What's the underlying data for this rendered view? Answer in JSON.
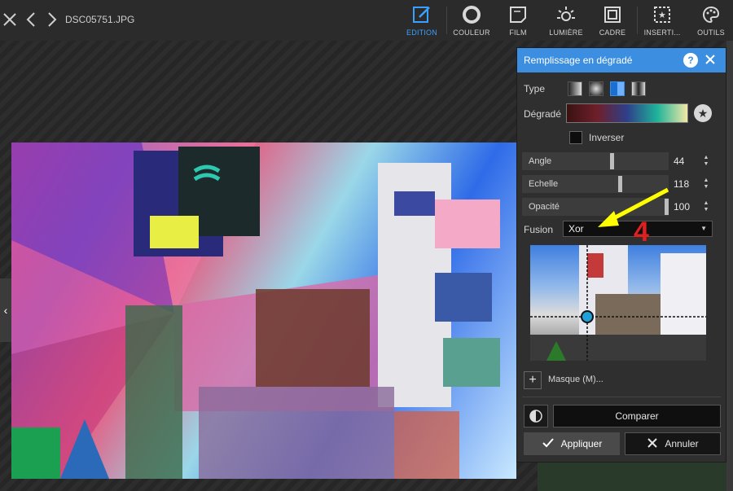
{
  "topbar": {
    "filename": "DSC05751.JPG",
    "tools": [
      {
        "label": "EDITION",
        "icon": "edit-icon",
        "active": true
      },
      {
        "label": "COULEUR",
        "icon": "color-circle-icon",
        "active": false
      },
      {
        "label": "FILM",
        "icon": "film-icon",
        "active": false
      },
      {
        "label": "LUMIÈRE",
        "icon": "sun-icon",
        "active": false
      },
      {
        "label": "CADRE",
        "icon": "frame-icon",
        "active": false
      },
      {
        "label": "INSERTI...",
        "icon": "insert-icon",
        "active": false
      },
      {
        "label": "OUTILS",
        "icon": "palette-icon",
        "active": false
      }
    ]
  },
  "dialog": {
    "title": "Remplissage en dégradé",
    "type_label": "Type",
    "gradient_label": "Dégradé",
    "invert_label": "Inverser",
    "sliders": [
      {
        "label": "Angle",
        "value": "44"
      },
      {
        "label": "Echelle",
        "value": "118"
      },
      {
        "label": "Opacité",
        "value": "100"
      }
    ],
    "fusion_label": "Fusion",
    "fusion_value": "Xor",
    "mask_label": "Masque (M)...",
    "compare_label": "Comparer",
    "apply_label": "Appliquer",
    "cancel_label": "Annuler"
  },
  "annotation": {
    "number": "4",
    "arrow_color": "#ffff00",
    "number_color": "#e02020"
  },
  "colors": {
    "accent": "#3c8ee0",
    "active_tool": "#3aa0ff"
  }
}
